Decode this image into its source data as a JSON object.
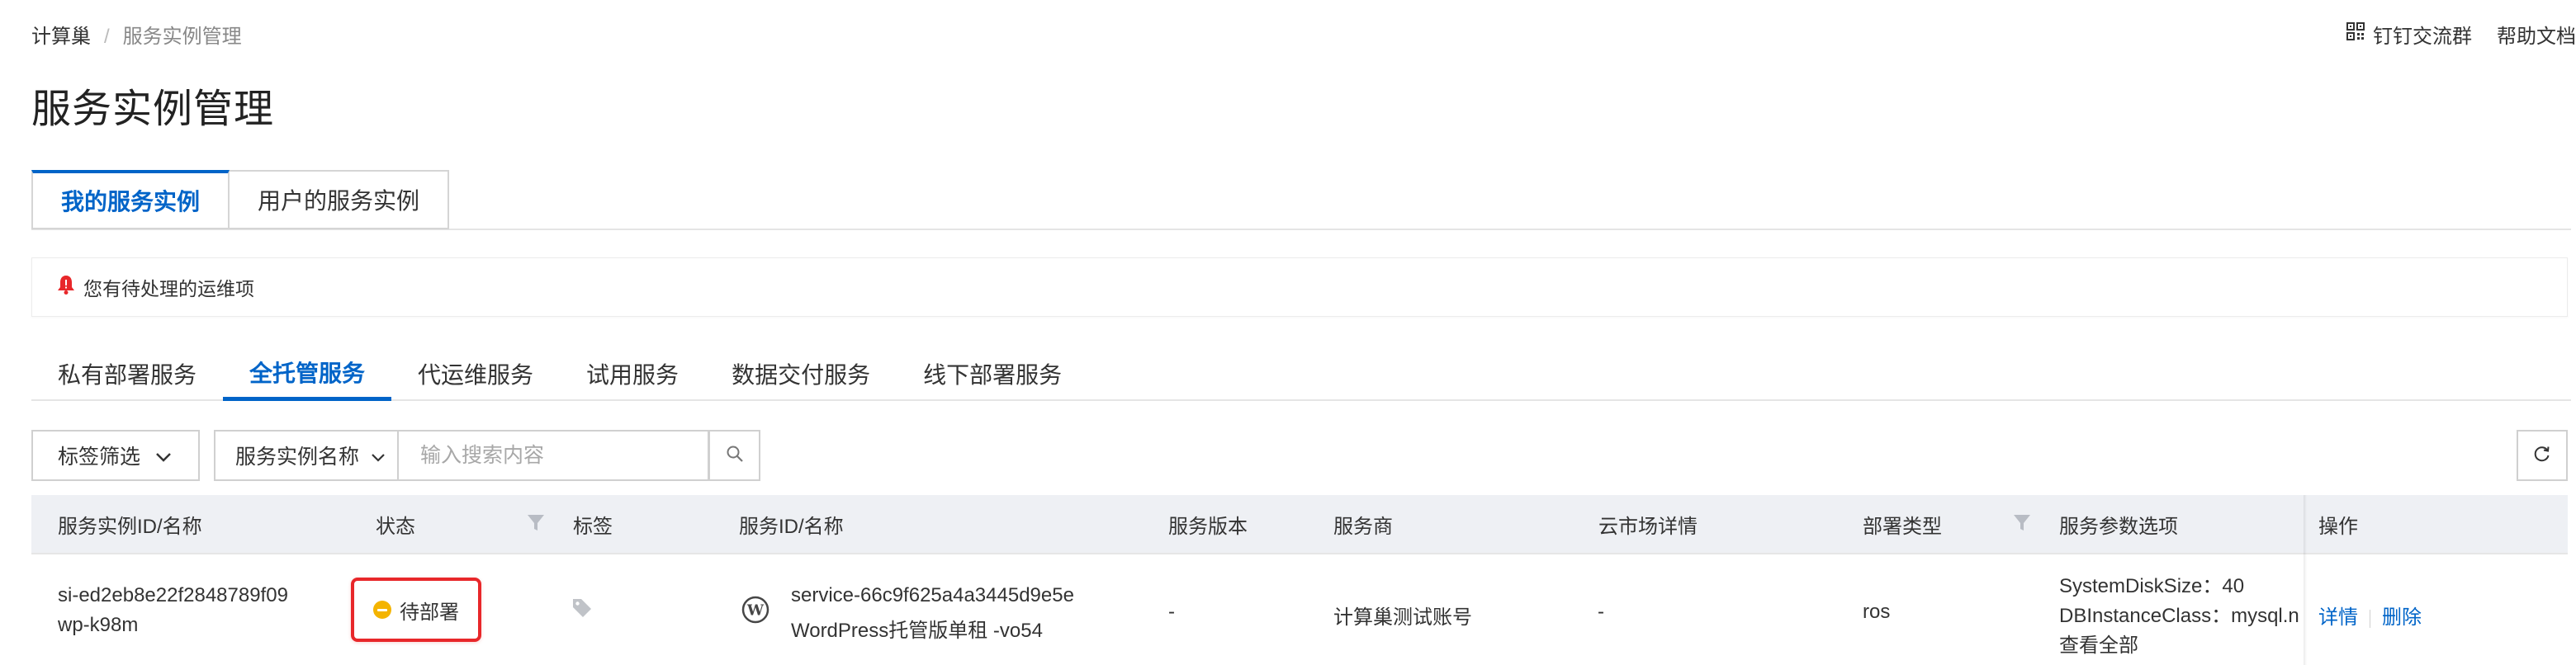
{
  "breadcrumb": {
    "root": "计算巢",
    "separator": "/",
    "current": "服务实例管理"
  },
  "header_links": {
    "dingtalk": "钉钉交流群",
    "help": "帮助文档"
  },
  "page_title": "服务实例管理",
  "main_tabs": [
    {
      "label": "我的服务实例",
      "active": true
    },
    {
      "label": "用户的服务实例",
      "active": false
    }
  ],
  "notice": {
    "text": "您有待处理的运维项"
  },
  "sub_tabs": [
    {
      "label": "私有部署服务",
      "active": false
    },
    {
      "label": "全托管服务",
      "active": true
    },
    {
      "label": "代运维服务",
      "active": false
    },
    {
      "label": "试用服务",
      "active": false
    },
    {
      "label": "数据交付服务",
      "active": false
    },
    {
      "label": "线下部署服务",
      "active": false
    }
  ],
  "filter": {
    "tag_filter_label": "标签筛选",
    "search_field_label": "服务实例名称",
    "search_placeholder": "输入搜索内容",
    "search_value": ""
  },
  "table": {
    "columns": [
      "服务实例ID/名称",
      "状态",
      "标签",
      "服务ID/名称",
      "服务版本",
      "服务商",
      "云市场详情",
      "部署类型",
      "服务参数选项",
      "操作"
    ],
    "rows": [
      {
        "instance_id": "si-ed2eb8e22f2848789f09",
        "instance_name": "wp-k98m",
        "status": "待部署",
        "service_id": "service-66c9f625a4a3445d9e5e",
        "service_name": "WordPress托管版单租 -vo54",
        "version": "-",
        "provider": "计算巢测试账号",
        "market": "-",
        "deploy_type": "ros",
        "params": [
          "SystemDiskSize：40",
          "DBInstanceClass：mysql.n"
        ],
        "params_more": "查看全部",
        "actions": {
          "detail": "详情",
          "delete": "删除"
        }
      }
    ]
  },
  "colors": {
    "accent": "#0064c8",
    "status_pending": "#f4b400",
    "highlight_border": "#e8272a"
  }
}
